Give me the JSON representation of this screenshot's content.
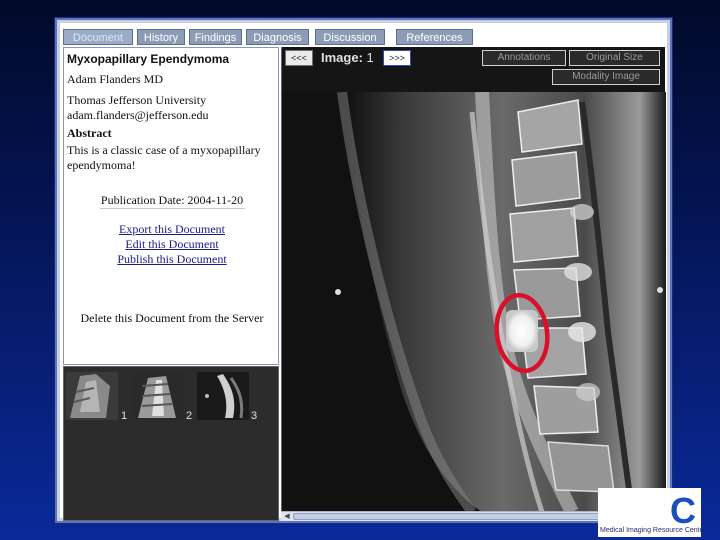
{
  "tabs": [
    {
      "label": "Document",
      "active": true
    },
    {
      "label": "History",
      "active": false
    },
    {
      "label": "Findings",
      "active": false
    },
    {
      "label": "Diagnosis",
      "active": false
    },
    {
      "label": "Discussion",
      "active": false
    },
    {
      "label": "References",
      "active": false
    }
  ],
  "document": {
    "title": "Myxopapillary Ependymoma",
    "author": "Adam Flanders MD",
    "institution": "Thomas Jefferson University",
    "email": "adam.flanders@jefferson.edu",
    "abstract_heading": "Abstract",
    "abstract_line1": "This is a classic case of a myxopapillary",
    "abstract_line2": "ependymoma!",
    "publication": "Publication Date: 2004-11-20",
    "export_link": "Export this Document",
    "edit_link": "Edit this Document",
    "publish_link": "Publish this Document",
    "delete_link": "Delete this Document from the Server"
  },
  "thumbnails": [
    {
      "number": "1"
    },
    {
      "number": "2"
    },
    {
      "number": "3"
    }
  ],
  "viewer": {
    "prev_label": "<<<",
    "next_label": ">>>",
    "image_label": "Image:",
    "image_number": "1",
    "annotations_label": "Annotations",
    "original_size_label": "Original Size",
    "modality_image_label": "Modality Image"
  },
  "logo": {
    "letter": "C",
    "caption": "Medical Imaging Resource Center"
  },
  "colors": {
    "background_top": "#020a2a",
    "background_bottom": "#0a2a9a",
    "tab": "#8c9cb6",
    "annotation_circle": "#d8102a",
    "link": "#1a1a8a"
  },
  "icons": {
    "scroll_left": "left-arrow-icon",
    "scroll_right": "right-arrow-icon"
  }
}
